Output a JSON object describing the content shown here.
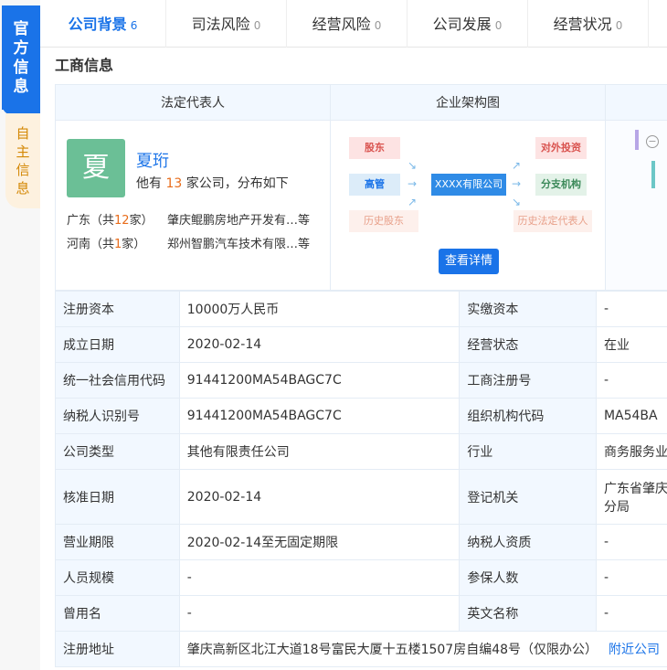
{
  "side_tabs": [
    {
      "label": "官方信息"
    },
    {
      "label": "自主信息"
    }
  ],
  "tabs": [
    {
      "label": "公司背景",
      "count": "6"
    },
    {
      "label": "司法风险",
      "count": "0"
    },
    {
      "label": "经营风险",
      "count": "0"
    },
    {
      "label": "公司发展",
      "count": "0"
    },
    {
      "label": "经营状况",
      "count": "0"
    }
  ],
  "section_title": "工商信息",
  "card": {
    "legal_rep_header": "法定代表人",
    "org_chart_header": "企业架构图",
    "avatar_char": "夏",
    "name": "夏珩",
    "sub_prefix": "他有",
    "sub_count": "13",
    "sub_suffix": "家公司，分布如下",
    "distribution": [
      {
        "region": "广东（共",
        "count": "12",
        "unit": "家）",
        "company": "肇庆鲲鹏房地产开发有…等"
      },
      {
        "region": "河南（共",
        "count": "1",
        "unit": "家）",
        "company": "郑州智鹏汽车技术有限…等"
      }
    ],
    "org": {
      "shareholder": "股东",
      "executive": "高管",
      "history_shareholder": "历史股东",
      "center": "XXXX有限公司",
      "investment": "对外投资",
      "branch": "分支机构",
      "history_legal": "历史法定代表人",
      "detail_button": "查看详情"
    },
    "colors": {
      "accent": "#1a73e8",
      "avatar": "#6bbf96",
      "highlight": "#e86c1a"
    }
  },
  "table": {
    "rows": [
      {
        "k1": "注册资本",
        "v1": "10000万人民币",
        "k2": "实缴资本",
        "v2": "-"
      },
      {
        "k1": "成立日期",
        "v1": "2020-02-14",
        "k2": "经营状态",
        "v2": "在业"
      },
      {
        "k1": "统一社会信用代码",
        "v1": "91441200MA54BAGC7C",
        "k2": "工商注册号",
        "v2": "-"
      },
      {
        "k1": "纳税人识别号",
        "v1": "91441200MA54BAGC7C",
        "k2": "组织机构代码",
        "v2": "MA54BA"
      },
      {
        "k1": "公司类型",
        "v1": "其他有限责任公司",
        "k2": "行业",
        "v2": "商务服务业"
      },
      {
        "k1": "核准日期",
        "v1": "2020-02-14",
        "k2": "登记机关",
        "v2": "广东省肇庆",
        "v2b": "分局"
      },
      {
        "k1": "营业期限",
        "v1": "2020-02-14至无固定期限",
        "k2": "纳税人资质",
        "v2": "-"
      },
      {
        "k1": "人员规模",
        "v1": "-",
        "k2": "参保人数",
        "v2": "-"
      },
      {
        "k1": "曾用名",
        "v1": "-",
        "k2": "英文名称",
        "v2": "-"
      }
    ],
    "address_label": "注册地址",
    "address_value": "肇庆高新区北江大道18号富民大厦十五楼1507房自编48号（仅限办公）",
    "address_link": "附近公司"
  }
}
